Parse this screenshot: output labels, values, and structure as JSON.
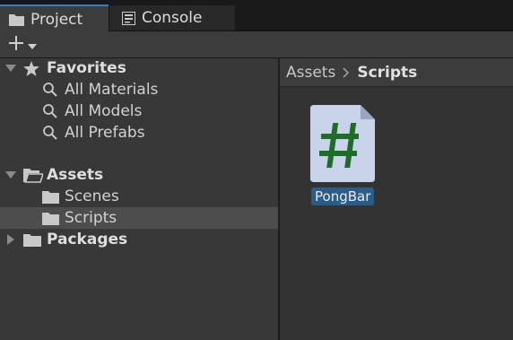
{
  "tabs": [
    {
      "label": "Project",
      "icon": "folder-icon"
    },
    {
      "label": "Console",
      "icon": "console-icon"
    }
  ],
  "toolbar": {
    "add_icon": "plus-icon",
    "dropdown_icon": "caret-down-icon"
  },
  "tree": {
    "favorites": {
      "label": "Favorites",
      "items": [
        "All Materials",
        "All Models",
        "All Prefabs"
      ]
    },
    "assets": {
      "label": "Assets",
      "items": [
        "Scenes",
        "Scripts"
      ],
      "selected": "Scripts"
    },
    "packages": {
      "label": "Packages"
    }
  },
  "breadcrumb": {
    "root": "Assets",
    "current": "Scripts"
  },
  "content": {
    "files": [
      {
        "name": "PongBar",
        "type": "C# script",
        "glyph": "#"
      }
    ]
  },
  "colors": {
    "accent": "#3a79bb",
    "selection": "#2c5d87",
    "script_icon_glyph": "#1e6b2a"
  }
}
